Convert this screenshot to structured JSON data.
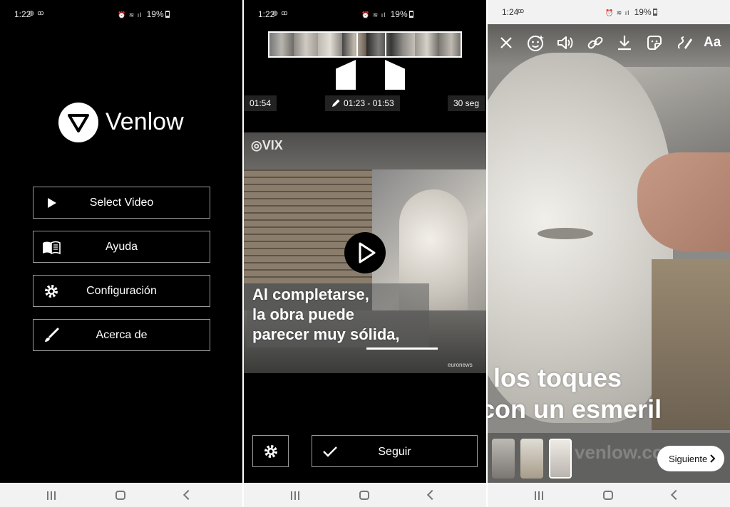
{
  "screen1": {
    "status": {
      "time": "1:22",
      "battery": "19%"
    },
    "app_name": "Venlow",
    "menu": [
      {
        "label": "Select Video",
        "icon": "play-icon"
      },
      {
        "label": "Ayuda",
        "icon": "book-icon"
      },
      {
        "label": "Configuración",
        "icon": "gear-icon"
      },
      {
        "label": "Acerca de",
        "icon": "brush-icon"
      }
    ]
  },
  "screen2": {
    "status": {
      "time": "1:22",
      "battery": "19%"
    },
    "duration_total": "01:54",
    "selection_range": "01:23 - 01:53",
    "selection_length": "30 seg",
    "watermark": "VIX",
    "caption_lines": [
      "Al completarse,",
      "la obra puede",
      "parecer muy sólida,"
    ],
    "source_mark": "euronews",
    "confirm_label": "Seguir"
  },
  "screen3": {
    "status": {
      "time": "1:24",
      "battery": "19%"
    },
    "toolbar": [
      "close-icon",
      "face-effects-icon",
      "sound-icon",
      "link-icon",
      "download-icon",
      "sticker-icon",
      "draw-icon"
    ],
    "text_tool_label": "Aa",
    "caption_lines": [
      "los toques",
      "con un esmeril"
    ],
    "overlay_mark": "venlow.com",
    "next_label": "Siguiente"
  }
}
